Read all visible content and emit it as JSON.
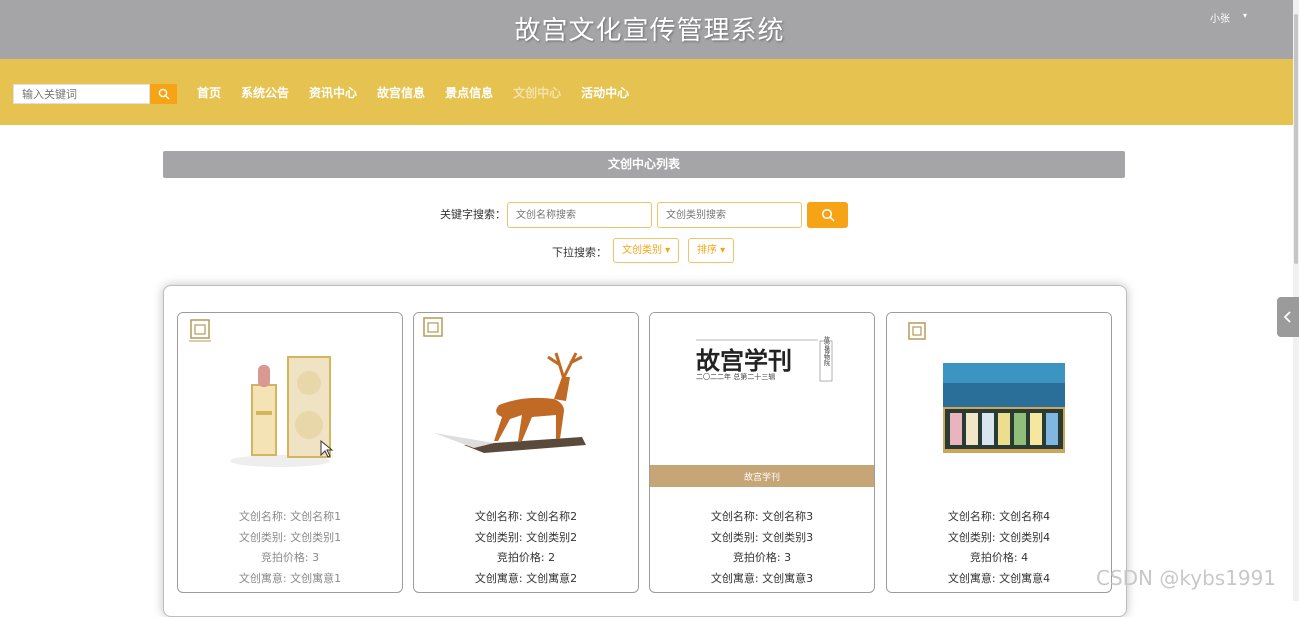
{
  "header": {
    "title": "故宫文化宣传管理系统",
    "user_name": "小张",
    "user_caret": "▾"
  },
  "nav": {
    "search_placeholder": "输入关键词",
    "items": [
      {
        "label": "首页"
      },
      {
        "label": "系统公告"
      },
      {
        "label": "资讯中心"
      },
      {
        "label": "故宫信息"
      },
      {
        "label": "景点信息"
      },
      {
        "label": "文创中心",
        "active": true
      },
      {
        "label": "活动中心"
      }
    ]
  },
  "section": {
    "title": "文创中心列表"
  },
  "filters": {
    "keyword_label": "关键字搜索：",
    "name_placeholder": "文创名称搜索",
    "category_placeholder": "文创类别搜索",
    "dropdown_label": "下拉搜索：",
    "category_dropdown": "文创类别 ▾",
    "sort_dropdown": "排序 ▾"
  },
  "products": [
    {
      "name_line": "文创名称: 文创名称1",
      "category_line": "文创类别: 文创类别1",
      "price_line": "竞拍价格: 3",
      "meaning_line": "文创寓意: 文创寓意1"
    },
    {
      "name_line": "文创名称: 文创名称2",
      "category_line": "文创类别: 文创类别2",
      "price_line": "竞拍价格: 2",
      "meaning_line": "文创寓意: 文创寓意2"
    },
    {
      "name_line": "文创名称: 文创名称3",
      "category_line": "文创类别: 文创类别3",
      "price_line": "竞拍价格: 3",
      "meaning_line": "文创寓意: 文创寓意3"
    },
    {
      "name_line": "文创名称: 文创名称4",
      "category_line": "文创类别: 文创类别4",
      "price_line": "竞拍价格: 4",
      "meaning_line": "文创寓意: 文创寓意4"
    }
  ],
  "images": {
    "magazine_title": "故宫学刊",
    "magazine_subtitle": "二〇二二年 总第二十三辑",
    "magazine_side": "故宫博物院",
    "magazine_banner": "故宫学刊"
  },
  "watermark": "CSDN @kybs1991",
  "colors": {
    "header_gray": "#a5a4a6",
    "nav_gold": "#e6c350",
    "accent_orange": "#f6a416"
  }
}
